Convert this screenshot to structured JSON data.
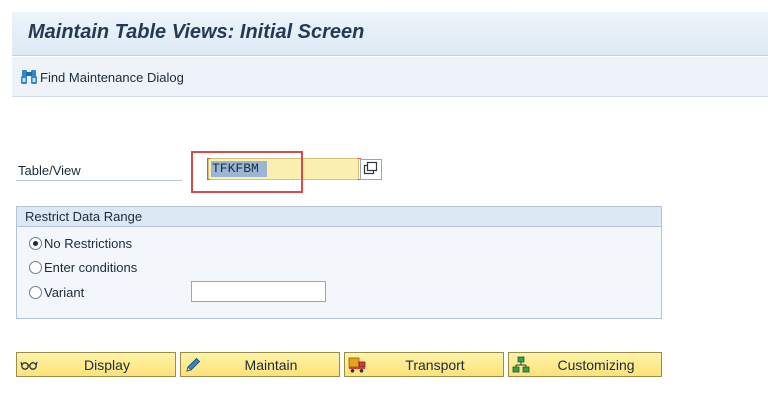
{
  "header": {
    "title": "Maintain Table Views: Initial Screen"
  },
  "toolbar": {
    "find_maintenance_dialog": {
      "label": "Find Maintenance Dialog",
      "icon": "binoculars-icon"
    }
  },
  "form": {
    "table_view": {
      "label": "Table/View",
      "value": "TFKFBM"
    },
    "restrict_data_range": {
      "title": "Restrict Data Range",
      "options": [
        {
          "label": "No Restrictions",
          "selected": true
        },
        {
          "label": "Enter conditions",
          "selected": false
        },
        {
          "label": "Variant",
          "selected": false
        }
      ],
      "variant_value": ""
    }
  },
  "actions": [
    {
      "label": "Display",
      "icon": "glasses-icon"
    },
    {
      "label": "Maintain",
      "icon": "pencil-icon"
    },
    {
      "label": "Transport",
      "icon": "truck-icon"
    },
    {
      "label": "Customizing",
      "icon": "hierarchy-icon"
    }
  ],
  "colors": {
    "title_bar": "#dde9f4",
    "input_required": "#fbefb1",
    "button_yellow": "#fde27a",
    "highlight_red": "#d94a4a"
  }
}
